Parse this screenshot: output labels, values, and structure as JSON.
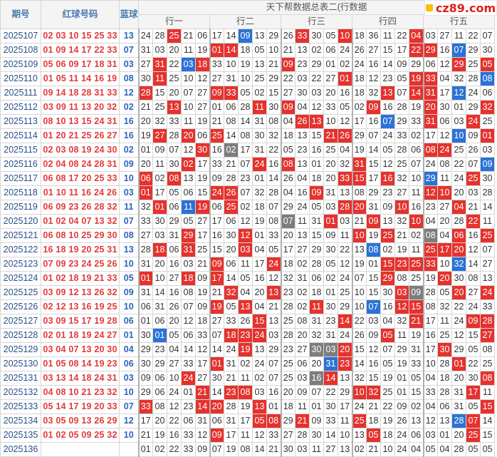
{
  "header": {
    "col_issue": "期号",
    "col_red": "红球号码",
    "col_blue": "蓝球",
    "title": "天下帮数据总表二(行数据",
    "groups": [
      "行一",
      "行二",
      "行三",
      "行四",
      "行五"
    ]
  },
  "logo": {
    "text": "cz89.com"
  },
  "colors": {
    "hit_red": "#e5322d",
    "hit_blue": "#2a72d6",
    "hit_gray": "#7d7d7d",
    "red_text": "#e23a3a",
    "blue_text": "#2a63c0"
  },
  "rows": [
    {
      "issue": "2025107",
      "red": "02 03 10 15 25 33",
      "blue": "13",
      "cells": [
        "24",
        "28",
        "25",
        "21",
        "06",
        "17",
        "14",
        "09",
        "13",
        "29",
        "26",
        "33",
        "30",
        "05",
        "10",
        "18",
        "36",
        "11",
        "22",
        "04",
        "03",
        "27",
        "11",
        "22",
        "07"
      ],
      "marks": "__r____b___r__r____r_____"
    },
    {
      "issue": "2025108",
      "red": "01 09 14 17 22 33",
      "blue": "07",
      "cells": [
        "31",
        "03",
        "20",
        "11",
        "19",
        "01",
        "14",
        "18",
        "05",
        "10",
        "21",
        "13",
        "02",
        "06",
        "24",
        "26",
        "27",
        "15",
        "17",
        "22",
        "29",
        "16",
        "07",
        "29",
        "30"
      ],
      "marks": "_____rr____________rr_b__"
    },
    {
      "issue": "2025109",
      "red": "05 06 09 17 18 31",
      "blue": "03",
      "cells": [
        "27",
        "31",
        "22",
        "03",
        "18",
        "33",
        "10",
        "19",
        "13",
        "21",
        "09",
        "23",
        "29",
        "01",
        "02",
        "24",
        "16",
        "14",
        "09",
        "29",
        "06",
        "12",
        "29",
        "25",
        "05"
      ],
      "marks": "_r_br_____r___________r_r"
    },
    {
      "issue": "2025110",
      "red": "01 05 11 14 16 19",
      "blue": "08",
      "cells": [
        "30",
        "11",
        "25",
        "10",
        "12",
        "27",
        "31",
        "10",
        "25",
        "29",
        "22",
        "03",
        "22",
        "27",
        "01",
        "18",
        "12",
        "23",
        "05",
        "19",
        "33",
        "04",
        "32",
        "28",
        "08"
      ],
      "marks": "_r____________r____rr___b"
    },
    {
      "issue": "2025111",
      "red": "09 14 18 28 31 33",
      "blue": "12",
      "cells": [
        "28",
        "15",
        "20",
        "07",
        "27",
        "09",
        "33",
        "05",
        "02",
        "15",
        "27",
        "30",
        "03",
        "20",
        "16",
        "18",
        "32",
        "13",
        "07",
        "14",
        "31",
        "17",
        "12",
        "24",
        "06"
      ],
      "marks": "r____rr__________r_rr_b__"
    },
    {
      "issue": "2025112",
      "red": "03 09 11 13 20 32",
      "blue": "02",
      "cells": [
        "21",
        "25",
        "13",
        "10",
        "27",
        "01",
        "06",
        "28",
        "11",
        "30",
        "09",
        "04",
        "12",
        "33",
        "05",
        "02",
        "09",
        "16",
        "28",
        "19",
        "20",
        "30",
        "01",
        "29",
        "32"
      ],
      "marks": "__r_____r_r_____r___r___r"
    },
    {
      "issue": "2025113",
      "red": "08 10 13 15 24 31",
      "blue": "16",
      "cells": [
        "20",
        "32",
        "33",
        "11",
        "19",
        "21",
        "08",
        "14",
        "31",
        "08",
        "04",
        "26",
        "13",
        "10",
        "12",
        "17",
        "16",
        "07",
        "29",
        "33",
        "31",
        "06",
        "03",
        "24",
        "25"
      ],
      "marks": "___________rr____b__r__r_"
    },
    {
      "issue": "2025114",
      "red": "01 20 21 25 26 27",
      "blue": "16",
      "cells": [
        "19",
        "27",
        "28",
        "20",
        "06",
        "25",
        "14",
        "08",
        "30",
        "32",
        "18",
        "13",
        "15",
        "21",
        "26",
        "29",
        "07",
        "24",
        "33",
        "02",
        "17",
        "12",
        "10",
        "09",
        "01"
      ],
      "marks": "_r_r_r_______rr_______b_r"
    },
    {
      "issue": "2025115",
      "red": "02 03 08 19 24 30",
      "blue": "02",
      "cells": [
        "01",
        "09",
        "07",
        "12",
        "30",
        "16",
        "02",
        "17",
        "31",
        "22",
        "05",
        "23",
        "16",
        "25",
        "04",
        "19",
        "14",
        "05",
        "28",
        "06",
        "08",
        "24",
        "25",
        "26",
        "03"
      ],
      "marks": "____r_g_____________rr___"
    },
    {
      "issue": "2025116",
      "red": "02 04 08 24 28 31",
      "blue": "09",
      "cells": [
        "20",
        "11",
        "30",
        "02",
        "17",
        "33",
        "21",
        "07",
        "24",
        "16",
        "08",
        "13",
        "01",
        "20",
        "32",
        "31",
        "15",
        "12",
        "25",
        "07",
        "24",
        "08",
        "22",
        "07",
        "09"
      ],
      "marks": "___r____r_r____r________b"
    },
    {
      "issue": "2025117",
      "red": "06 08 17 20 25 33",
      "blue": "10",
      "cells": [
        "06",
        "02",
        "08",
        "13",
        "19",
        "09",
        "28",
        "23",
        "01",
        "14",
        "26",
        "04",
        "18",
        "20",
        "33",
        "15",
        "17",
        "16",
        "32",
        "10",
        "29",
        "11",
        "24",
        "25",
        "30"
      ],
      "marks": "r_r___________rr_r__b__r_"
    },
    {
      "issue": "2025118",
      "red": "01 10 11 16 24 26",
      "blue": "03",
      "cells": [
        "01",
        "17",
        "05",
        "06",
        "15",
        "24",
        "26",
        "07",
        "32",
        "28",
        "04",
        "16",
        "09",
        "31",
        "13",
        "08",
        "29",
        "23",
        "27",
        "11",
        "12",
        "10",
        "20",
        "03",
        "28"
      ],
      "marks": "r____rr_____r_______rr___"
    },
    {
      "issue": "2025119",
      "red": "06 09 23 26 28 32",
      "blue": "11",
      "cells": [
        "32",
        "01",
        "06",
        "11",
        "19",
        "06",
        "25",
        "02",
        "18",
        "07",
        "29",
        "24",
        "05",
        "03",
        "28",
        "20",
        "31",
        "09",
        "10",
        "16",
        "23",
        "27",
        "04",
        "21",
        "14"
      ],
      "marks": "_r_br_r_______rr__r___r__"
    },
    {
      "issue": "2025120",
      "red": "01 02 04 07 13 32",
      "blue": "07",
      "cells": [
        "33",
        "30",
        "29",
        "05",
        "27",
        "17",
        "06",
        "12",
        "19",
        "08",
        "07",
        "11",
        "31",
        "01",
        "03",
        "21",
        "09",
        "13",
        "32",
        "10",
        "04",
        "20",
        "28",
        "22",
        "11"
      ],
      "marks": "__________g__r__r__r___r_"
    },
    {
      "issue": "2025121",
      "red": "06 08 10 25 29 30",
      "blue": "08",
      "cells": [
        "27",
        "03",
        "31",
        "29",
        "17",
        "16",
        "30",
        "12",
        "01",
        "33",
        "20",
        "13",
        "15",
        "09",
        "11",
        "10",
        "19",
        "25",
        "21",
        "02",
        "08",
        "04",
        "06",
        "16",
        "25"
      ],
      "marks": "___r___r_______r_r__g_r_r"
    },
    {
      "issue": "2025122",
      "red": "16 18 19 20 25 31",
      "blue": "13",
      "cells": [
        "28",
        "18",
        "06",
        "31",
        "25",
        "15",
        "20",
        "03",
        "04",
        "05",
        "17",
        "27",
        "29",
        "30",
        "22",
        "13",
        "08",
        "02",
        "19",
        "11",
        "25",
        "17",
        "20",
        "12",
        "07"
      ],
      "marks": "_r_r___r________b___rrr__"
    },
    {
      "issue": "2025123",
      "red": "07 09 23 24 25 26",
      "blue": "10",
      "cells": [
        "31",
        "20",
        "16",
        "03",
        "21",
        "09",
        "06",
        "11",
        "17",
        "24",
        "18",
        "02",
        "28",
        "05",
        "12",
        "19",
        "01",
        "15",
        "23",
        "25",
        "33",
        "10",
        "32",
        "14",
        "27"
      ],
      "marks": "_____r___r_______rrrr_b__"
    },
    {
      "issue": "2025124",
      "red": "01 02 18 19 21 33",
      "blue": "05",
      "cells": [
        "01",
        "10",
        "27",
        "18",
        "09",
        "17",
        "14",
        "05",
        "16",
        "12",
        "32",
        "31",
        "06",
        "02",
        "24",
        "07",
        "15",
        "29",
        "08",
        "25",
        "19",
        "20",
        "30",
        "08",
        "13"
      ],
      "marks": "r__r_r___________r___r___"
    },
    {
      "issue": "2025125",
      "red": "03 09 12 13 26 32",
      "blue": "09",
      "cells": [
        "31",
        "14",
        "16",
        "08",
        "19",
        "21",
        "32",
        "04",
        "20",
        "13",
        "23",
        "02",
        "18",
        "01",
        "25",
        "10",
        "15",
        "30",
        "03",
        "09",
        "28",
        "05",
        "20",
        "27",
        "24"
      ],
      "marks": "______r__r________rg__r_r"
    },
    {
      "issue": "2025126",
      "red": "02 12 13 16 19 25",
      "blue": "10",
      "cells": [
        "06",
        "31",
        "26",
        "07",
        "09",
        "19",
        "05",
        "13",
        "04",
        "21",
        "28",
        "02",
        "11",
        "30",
        "29",
        "10",
        "07",
        "16",
        "12",
        "15",
        "08",
        "32",
        "22",
        "24",
        "33"
      ],
      "marks": "_____r_r____r___b_rr_____"
    },
    {
      "issue": "2025127",
      "red": "03 09 15 17 19 28",
      "blue": "06",
      "cells": [
        "01",
        "06",
        "20",
        "12",
        "18",
        "27",
        "33",
        "26",
        "15",
        "13",
        "25",
        "08",
        "31",
        "23",
        "14",
        "22",
        "03",
        "04",
        "32",
        "21",
        "17",
        "11",
        "24",
        "09",
        "28"
      ],
      "marks": "________r_____r____r___rr"
    },
    {
      "issue": "2025128",
      "red": "02 01 18 19 24 27",
      "blue": "01",
      "cells": [
        "30",
        "01",
        "05",
        "06",
        "33",
        "07",
        "18",
        "23",
        "24",
        "03",
        "28",
        "20",
        "32",
        "31",
        "24",
        "26",
        "09",
        "05",
        "11",
        "19",
        "16",
        "25",
        "12",
        "15",
        "27"
      ],
      "marks": "_b____rrr________r______r"
    },
    {
      "issue": "2025129",
      "red": "03 04 07 13 20 30",
      "blue": "04",
      "cells": [
        "29",
        "23",
        "04",
        "14",
        "12",
        "14",
        "24",
        "19",
        "13",
        "29",
        "23",
        "27",
        "30",
        "03",
        "20",
        "15",
        "12",
        "07",
        "29",
        "31",
        "17",
        "30",
        "29",
        "05",
        "08"
      ],
      "marks": "_______r____ggr______r___"
    },
    {
      "issue": "2025130",
      "red": "01 05 08 14 19 23",
      "blue": "06",
      "cells": [
        "30",
        "29",
        "27",
        "33",
        "17",
        "01",
        "31",
        "02",
        "24",
        "07",
        "25",
        "06",
        "20",
        "31",
        "23",
        "14",
        "16",
        "05",
        "19",
        "33",
        "10",
        "28",
        "01",
        "22",
        "25"
      ],
      "marks": "_____r_______br_______r__"
    },
    {
      "issue": "2025131",
      "red": "03 13 14 18 24 31",
      "blue": "03",
      "cells": [
        "09",
        "06",
        "10",
        "24",
        "27",
        "30",
        "21",
        "11",
        "02",
        "07",
        "25",
        "03",
        "16",
        "14",
        "13",
        "32",
        "15",
        "19",
        "01",
        "05",
        "04",
        "18",
        "20",
        "30",
        "08"
      ],
      "marks": "___r________gr__________r"
    },
    {
      "issue": "2025132",
      "red": "04 08 10 21 23 32",
      "blue": "10",
      "cells": [
        "29",
        "06",
        "24",
        "01",
        "21",
        "14",
        "23",
        "08",
        "03",
        "16",
        "20",
        "09",
        "07",
        "22",
        "29",
        "10",
        "32",
        "25",
        "01",
        "15",
        "33",
        "28",
        "31",
        "17",
        "11"
      ],
      "marks": "____r_rr_______rr______r_"
    },
    {
      "issue": "2025133",
      "red": "05 14 17 19 20 33",
      "blue": "07",
      "cells": [
        "33",
        "08",
        "12",
        "23",
        "14",
        "20",
        "28",
        "19",
        "13",
        "01",
        "18",
        "11",
        "01",
        "30",
        "17",
        "24",
        "21",
        "22",
        "09",
        "02",
        "04",
        "06",
        "31",
        "05",
        "15"
      ],
      "marks": "r___rr__r_______________r"
    },
    {
      "issue": "2025134",
      "red": "03 05 09 13 26 29",
      "blue": "12",
      "cells": [
        "17",
        "20",
        "22",
        "06",
        "31",
        "06",
        "31",
        "17",
        "05",
        "08",
        "29",
        "21",
        "09",
        "33",
        "11",
        "25",
        "18",
        "19",
        "26",
        "13",
        "12",
        "13",
        "28",
        "07",
        "14"
      ],
      "marks": "________rr_r___r______br_"
    },
    {
      "issue": "2025135",
      "red": "01 02 05 09 25 32",
      "blue": "10",
      "cells": [
        "21",
        "19",
        "16",
        "33",
        "12",
        "09",
        "17",
        "11",
        "12",
        "33",
        "27",
        "28",
        "30",
        "14",
        "10",
        "13",
        "05",
        "18",
        "24",
        "06",
        "03",
        "01",
        "20",
        "25",
        "15"
      ],
      "marks": "_____r__________r______r_"
    },
    {
      "issue": "2025136",
      "red": "",
      "blue": "",
      "cells": [
        "01",
        "02",
        "22",
        "33",
        "09",
        "07",
        "19",
        "08",
        "14",
        "21",
        "30",
        "03",
        "11",
        "27",
        "13",
        "02",
        "21",
        "10",
        "24",
        "04",
        "05",
        "04",
        "28",
        "05",
        "05"
      ],
      "marks": "_________________________"
    }
  ]
}
